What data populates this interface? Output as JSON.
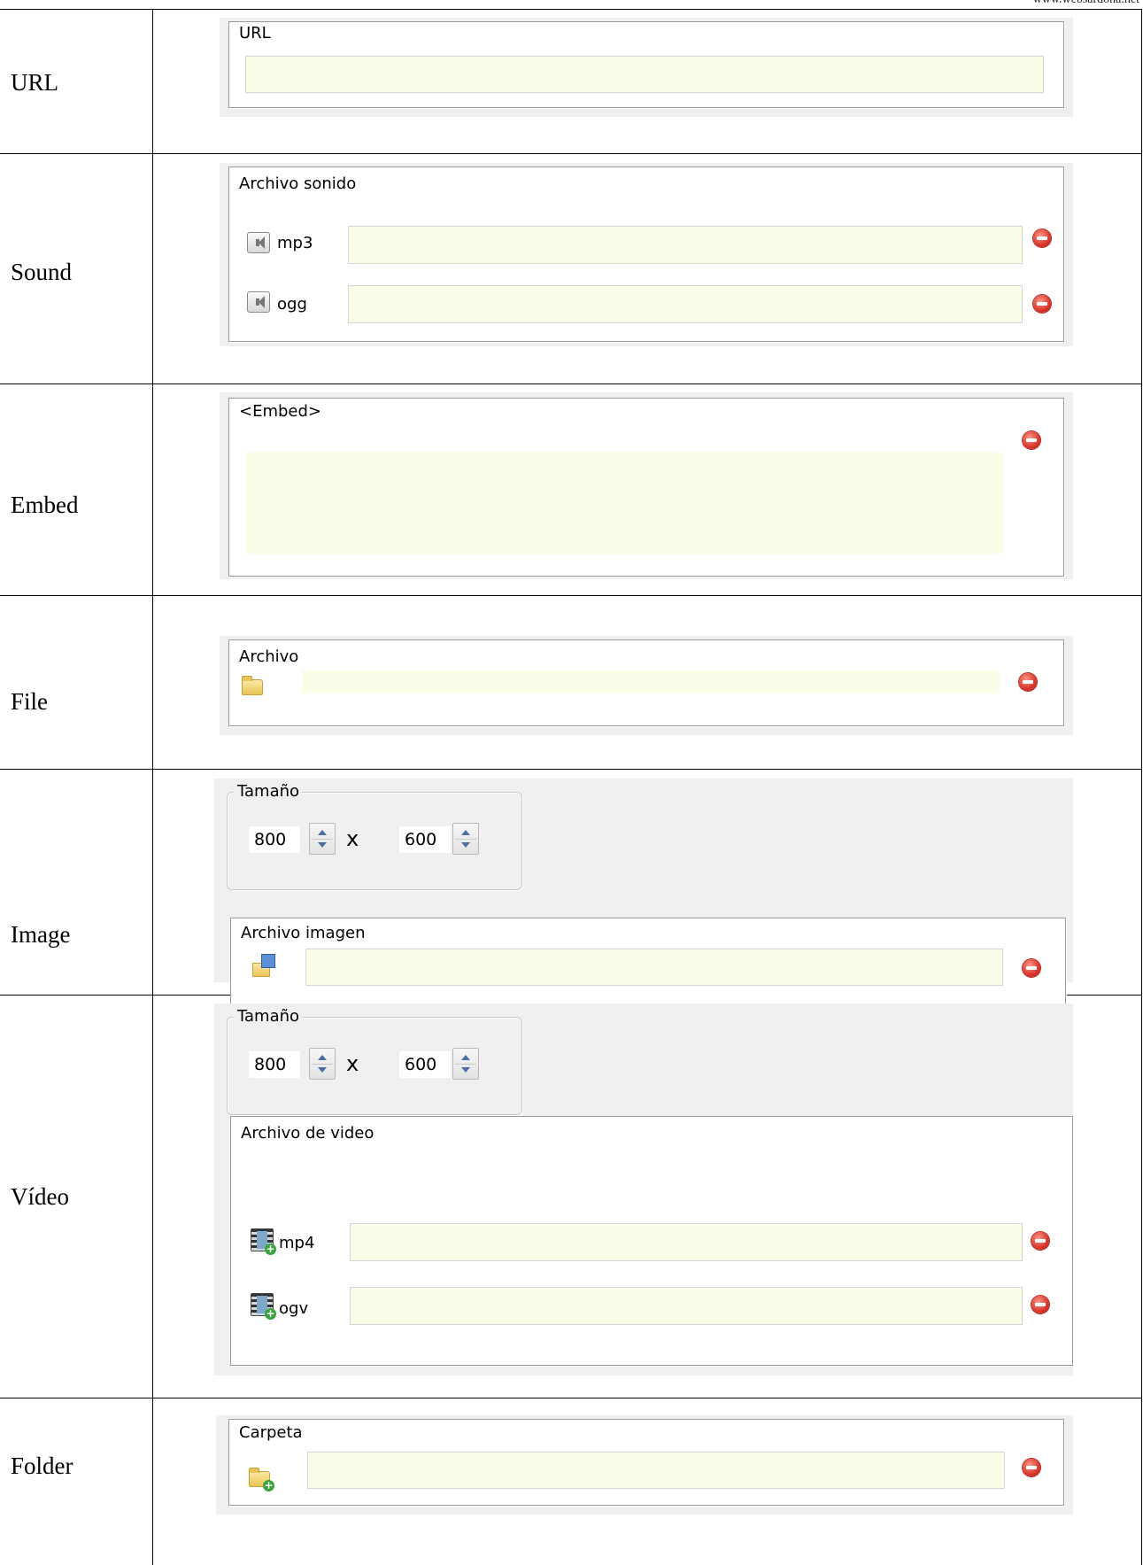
{
  "watermark": "www.websardona.net",
  "rows": [
    {
      "label": "URL",
      "group_title": "URL"
    },
    {
      "label": "Sound",
      "group_title": "Archivo sonido",
      "items": [
        "mp3",
        "ogg"
      ]
    },
    {
      "label": "Embed",
      "group_title": "<Embed>"
    },
    {
      "label": "File",
      "group_title": "Archivo"
    },
    {
      "label": "Image",
      "size_title": "Tamaño",
      "width": "800",
      "height": "600",
      "times": "x",
      "group_title": "Archivo imagen"
    },
    {
      "label": "Vídeo",
      "size_title": "Tamaño",
      "width": "800",
      "height": "600",
      "times": "x",
      "group_title": "Archivo de video",
      "items": [
        "mp4",
        "ogv"
      ]
    },
    {
      "label": "Folder",
      "group_title": "Carpeta"
    }
  ],
  "colors": {
    "field_bg": "#fafde8",
    "panel_bg": "#f0f0f0",
    "remove_icon": "#d9352b"
  },
  "icons": [
    "speaker-icon",
    "remove-icon",
    "folder-icon",
    "image-file-icon",
    "film-icon",
    "add-folder-icon"
  ]
}
